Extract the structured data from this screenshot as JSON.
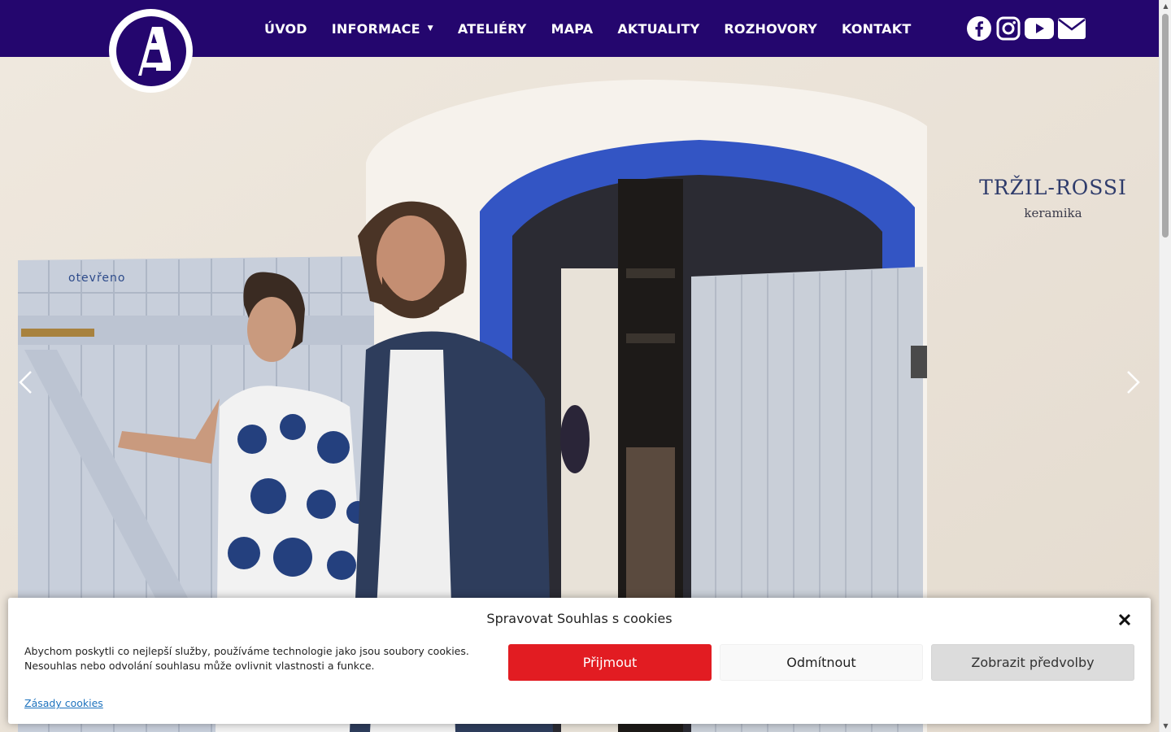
{
  "header": {
    "bg_color": "#24066e",
    "logo_icon": "circle-a-logo-icon",
    "nav": [
      {
        "label": "ÚVOD"
      },
      {
        "label": "INFORMACE",
        "has_dropdown": true
      },
      {
        "label": "ATELIÉRY"
      },
      {
        "label": "MAPA"
      },
      {
        "label": "AKTUALITY"
      },
      {
        "label": "ROZHOVORY"
      },
      {
        "label": "KONTAKT"
      }
    ],
    "socials": [
      "facebook-icon",
      "instagram-icon",
      "youtube-icon",
      "envelope-icon"
    ]
  },
  "hero": {
    "shop_sign_name": "TRŽIL-ROSSI",
    "shop_sign_sub": "keramika",
    "door_sign": "otevřeno",
    "door_color": "#3355c4",
    "prev_icon": "chevron-left-icon",
    "next_icon": "chevron-right-icon"
  },
  "cookie": {
    "title": "Spravovat Souhlas s cookies",
    "text": "Abychom poskytli co nejlepší služby, používáme technologie jako jsou soubory cookies. Nesouhlas nebo odvolání souhlasu může ovlivnit vlastnosti a funkce.",
    "link": "Zásady cookies",
    "accept": "Přijmout",
    "deny": "Odmítnout",
    "prefs": "Zobrazit předvolby",
    "accept_color": "#e21c22"
  }
}
